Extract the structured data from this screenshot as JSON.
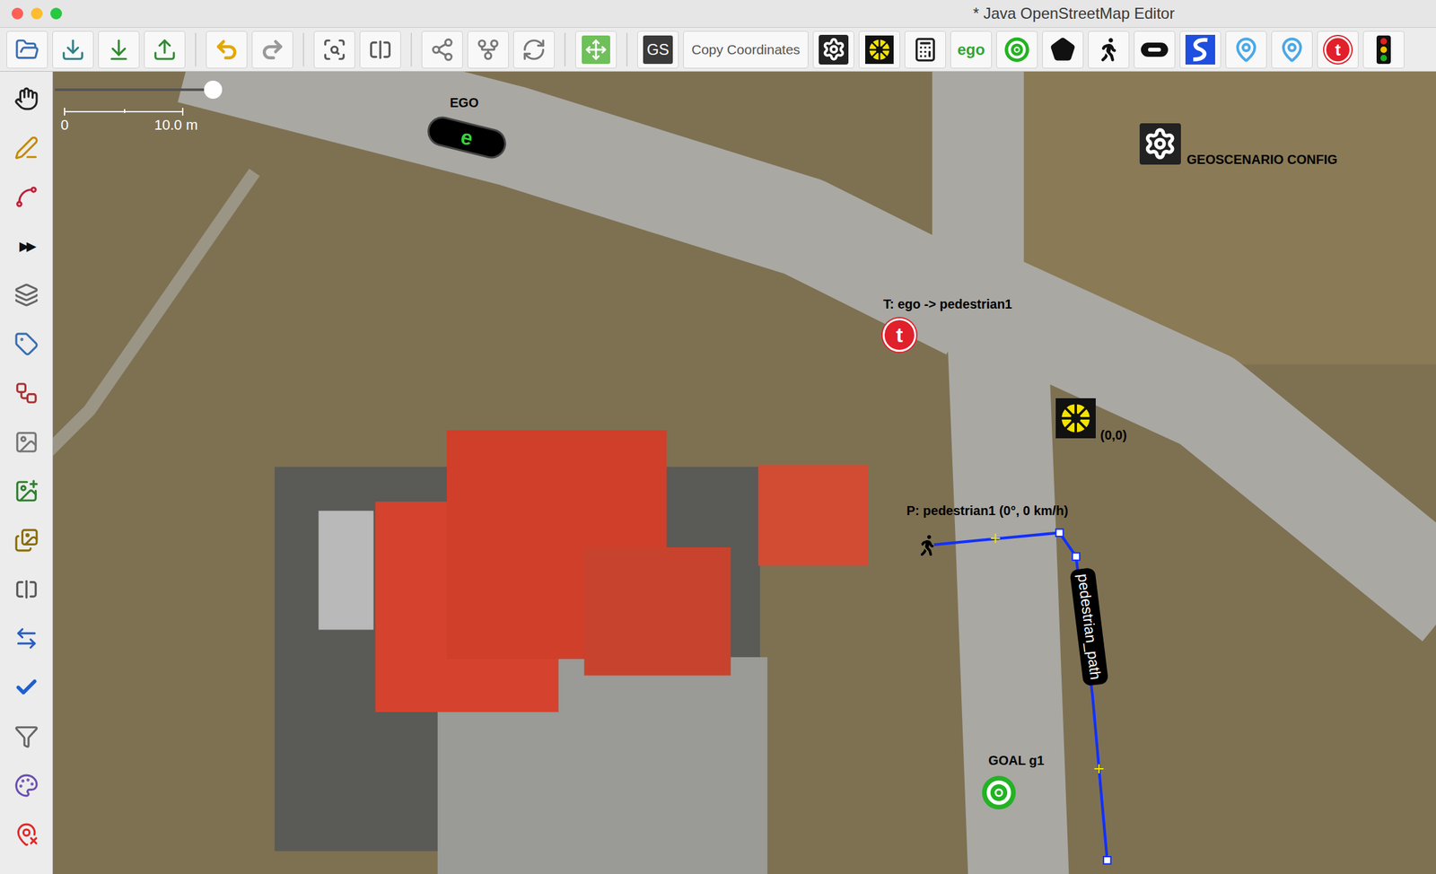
{
  "window": {
    "title": "* Java OpenStreetMap Editor"
  },
  "toolbar": {
    "gs_button": "GS",
    "copy_button": "Copy Coordinates",
    "ego_button": "ego",
    "trigger_button": "t"
  },
  "left_toolbar": {
    "overflow": "▶▶"
  },
  "map": {
    "zoom_level": 0.96,
    "scale": {
      "start": "0",
      "end": "10.0 m"
    },
    "ego": {
      "label": "EGO",
      "badge": "e"
    },
    "config": {
      "label": "GEOSCENARIO CONFIG"
    },
    "trigger": {
      "label": "T: ego -> pedestrian1",
      "badge": "t"
    },
    "origin": {
      "label": "(0,0)"
    },
    "pedestrian": {
      "label": "P: pedestrian1 (0°, 0 km/h)"
    },
    "path": {
      "label": "pedestrian_path"
    },
    "goal": {
      "label": "GOAL g1"
    }
  }
}
